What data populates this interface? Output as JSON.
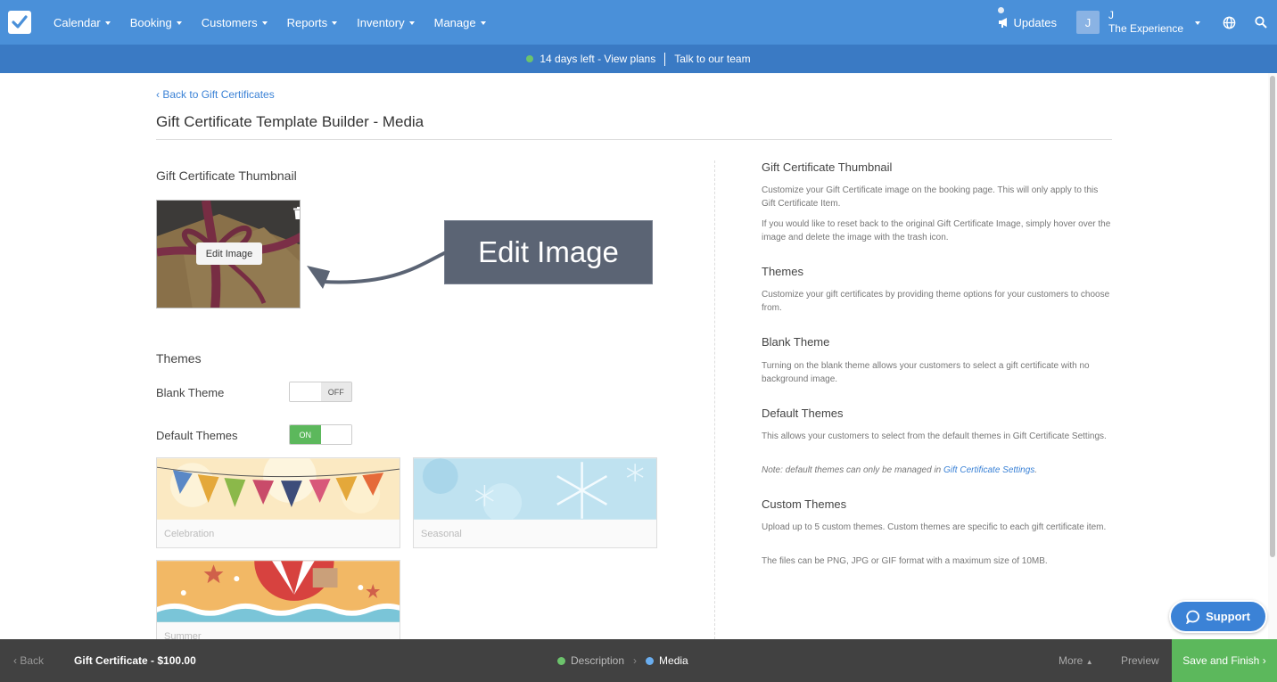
{
  "nav": {
    "items": [
      {
        "label": "Calendar"
      },
      {
        "label": "Booking"
      },
      {
        "label": "Customers"
      },
      {
        "label": "Reports"
      },
      {
        "label": "Inventory"
      },
      {
        "label": "Manage"
      }
    ],
    "updates_label": "Updates",
    "user_initial": "J",
    "user_line1": "J",
    "user_line2": "The Experience",
    "icons": [
      "megaphone-icon",
      "globe-icon",
      "search-icon",
      "checkmark-logo-icon"
    ]
  },
  "trial": {
    "days_left": "14 days left - View plans",
    "talk": "Talk to our team"
  },
  "page": {
    "back_link": "Back to Gift Certificates",
    "title": "Gift Certificate Template Builder - Media"
  },
  "left": {
    "thumbnail_heading": "Gift Certificate Thumbnail",
    "edit_image_button": "Edit Image",
    "callout_text": "Edit Image",
    "themes_heading": "Themes",
    "blank_theme_label": "Blank Theme",
    "blank_theme_toggle": "OFF",
    "default_themes_label": "Default Themes",
    "default_themes_toggle": "ON",
    "theme_cards": [
      {
        "name": "Celebration"
      },
      {
        "name": "Seasonal"
      },
      {
        "name": "Summer"
      }
    ]
  },
  "right": {
    "sections": [
      {
        "heading": "Gift Certificate Thumbnail",
        "paragraphs": [
          "Customize your Gift Certificate image on the booking page. This will only apply to this Gift Certificate Item.",
          "If you would like to reset back to the original Gift Certificate Image, simply hover over the image and delete the image with the trash icon."
        ]
      },
      {
        "heading": "Themes",
        "paragraphs": [
          "Customize your gift certificates by providing theme options for your customers to choose from."
        ]
      },
      {
        "heading": "Blank Theme",
        "paragraphs": [
          "Turning on the blank theme allows your customers to select a gift certificate with no background image."
        ]
      },
      {
        "heading": "Default Themes",
        "paragraphs": [
          "This allows your customers to select from the default themes in Gift Certificate Settings."
        ],
        "note_prefix": "Note: default themes can only be managed in ",
        "note_link": "Gift Certificate Settings",
        "note_suffix": "."
      },
      {
        "heading": "Custom Themes",
        "paragraphs": [
          "Upload up to 5 custom themes. Custom themes are specific to each gift certificate item.",
          "The files can be PNG, JPG or GIF format with a maximum size of 10MB."
        ]
      }
    ]
  },
  "support_label": "Support",
  "bottom": {
    "back": "Back",
    "title": "Gift Certificate - $100.00",
    "step1": "Description",
    "step2": "Media",
    "more": "More",
    "preview": "Preview",
    "save": "Save and Finish"
  },
  "colors": {
    "nav_blue": "#4a90d9",
    "trial_blue": "#3a7ac4",
    "green": "#5cb85c",
    "link": "#3b82d6"
  }
}
